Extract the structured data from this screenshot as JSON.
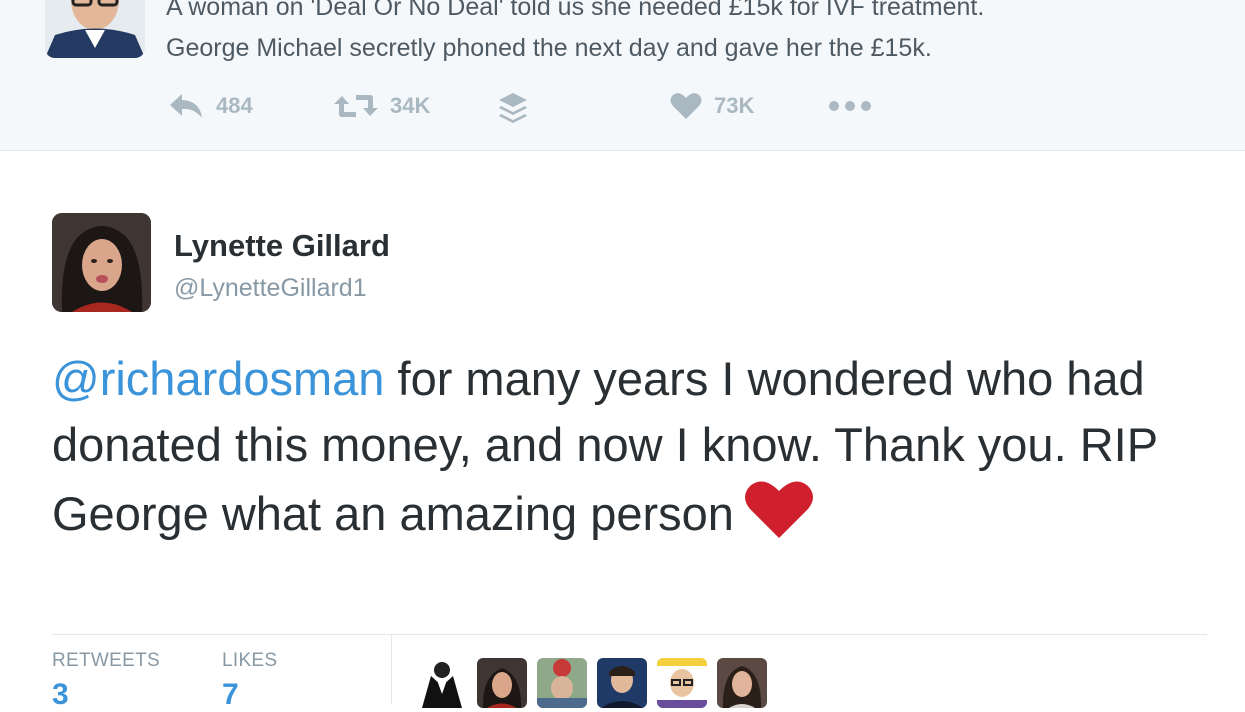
{
  "quoted_tweet": {
    "line1": "A woman on 'Deal Or No Deal' told us she needed £15k for IVF treatment.",
    "line2": "George Michael secretly phoned the next day and gave her the £15k.",
    "actions": {
      "reply_count": "484",
      "retweet_count": "34K",
      "like_count": "73K"
    },
    "icons": [
      "reply-icon",
      "retweet-icon",
      "buffer-stack-icon",
      "heart-icon",
      "more-icon"
    ]
  },
  "tweet": {
    "name": "Lynette Gillard",
    "handle": "@LynetteGillard1",
    "mention": "@richardosman",
    "text": " for many years I wondered who had donated this money, and now I know. Thank you. RIP George what an amazing person",
    "emoji": "red-heart-emoji"
  },
  "stats": {
    "retweets_label": "RETWEETS",
    "retweets_value": "3",
    "likes_label": "LIKES",
    "likes_value": "7"
  },
  "colors": {
    "mention": "#3b94d9",
    "action_icon": "#aab8c2",
    "heart_emoji": "#d0202e",
    "quoted_bg": "#f5f8fa"
  }
}
